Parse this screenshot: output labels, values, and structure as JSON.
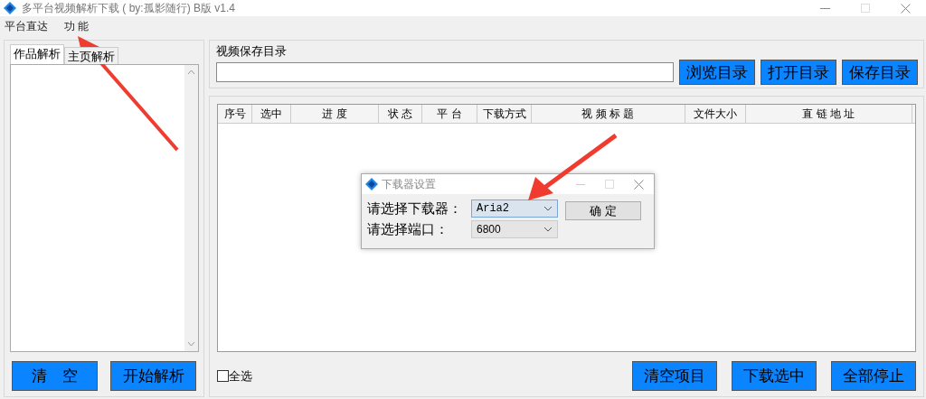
{
  "window": {
    "title": "多平台视频解析下载 ( by:孤影随行) B版 v1.4"
  },
  "menu": [
    {
      "label": "平台直达"
    },
    {
      "label": "功 能"
    }
  ],
  "left_panel": {
    "tabs": [
      {
        "label": "作品解析",
        "selected": true
      },
      {
        "label": "主页解析",
        "selected": false
      }
    ],
    "buttons": [
      "清　空",
      "开始解析"
    ]
  },
  "save_dir": {
    "label": "视频保存目录",
    "buttons": [
      "浏览目录",
      "打开目录",
      "保存目录"
    ]
  },
  "table": {
    "columns": [
      "序号",
      "选中",
      "进 度",
      "状 态",
      "平 台",
      "下载方式",
      "视 频 标 题",
      "文件大小",
      "直 链 地 址"
    ]
  },
  "select_all": {
    "label": "全选",
    "checked": false
  },
  "bottom_buttons": [
    "清空项目",
    "下载选中",
    "全部停止"
  ],
  "dialog": {
    "title": "下载器设置",
    "fields": [
      {
        "label": "请选择下载器：",
        "value": "Aria2",
        "focused": true
      },
      {
        "label": "请选择端口：",
        "value": "6800",
        "focused": false
      }
    ],
    "button": "确 定"
  }
}
